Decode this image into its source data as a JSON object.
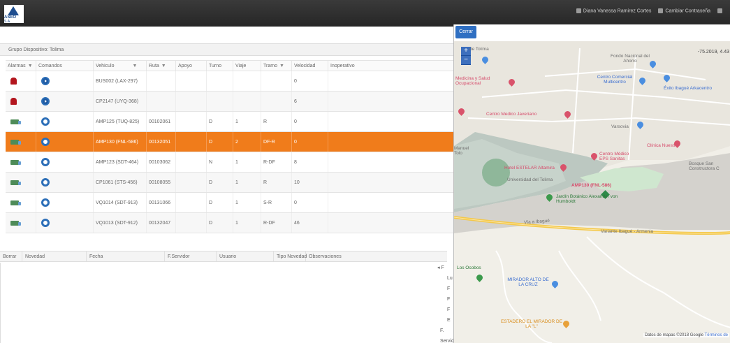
{
  "header": {
    "logo_text": "ASEO",
    "logo_sub": "S.A.",
    "user_name": "Diana Vanessa Ramirez Cortes",
    "change_password": "Cambiar Contraseña"
  },
  "group": {
    "label": "Grupo Dispositivo: Tolima"
  },
  "device_table": {
    "columns": [
      "Alarmas",
      "Comandos",
      "Vehiculo",
      "Ruta",
      "Apoyo",
      "Turno",
      "Viaje",
      "Tramo",
      "Velocidad",
      "Inoperativo"
    ],
    "rows": [
      {
        "vehicle": "BUS002 (LAX-297)",
        "route": "",
        "support": "",
        "shift": "",
        "trip": "",
        "segment": "",
        "speed": "0",
        "alarm": "alarm-bell",
        "command": "play"
      },
      {
        "vehicle": "CP2147 (UYQ-368)",
        "route": "",
        "support": "",
        "shift": "",
        "trip": "",
        "segment": "",
        "speed": "6",
        "alarm": "alarm-bell",
        "command": "play"
      },
      {
        "vehicle": "AMP125 (TUQ-825)",
        "route": "00102061",
        "support": "",
        "shift": "D",
        "trip": "1",
        "segment": "R",
        "speed": "0",
        "alarm": "truck",
        "command": "ring"
      },
      {
        "vehicle": "AMP130 (FNL-586)",
        "route": "00132051",
        "support": "",
        "shift": "D",
        "trip": "2",
        "segment": "DF-R",
        "speed": "0",
        "alarm": "truck",
        "command": "ring",
        "selected": true
      },
      {
        "vehicle": "AMP123 (SDT-464)",
        "route": "00103062",
        "support": "",
        "shift": "N",
        "trip": "1",
        "segment": "R-DF",
        "speed": "8",
        "alarm": "truck",
        "command": "ring"
      },
      {
        "vehicle": "CP1061 (STS-456)",
        "route": "00108055",
        "support": "",
        "shift": "D",
        "trip": "1",
        "segment": "R",
        "speed": "10",
        "alarm": "truck",
        "command": "ring"
      },
      {
        "vehicle": "VQ1014 (SDT-913)",
        "route": "00131066",
        "support": "",
        "shift": "D",
        "trip": "1",
        "segment": "S-R",
        "speed": "0",
        "alarm": "truck",
        "command": "ring"
      },
      {
        "vehicle": "VQ1013 (SDT-912)",
        "route": "00132047",
        "support": "",
        "shift": "D",
        "trip": "1",
        "segment": "R-DF",
        "speed": "46",
        "alarm": "truck",
        "command": "ring"
      }
    ]
  },
  "events_table": {
    "columns": [
      "Borrar",
      "Novedad",
      "Fecha",
      "F.Servidor",
      "Usuario",
      "Tipo Novedad",
      "Observaciones"
    ]
  },
  "side_strip": {
    "rows": [
      "F",
      "Lu",
      "F",
      "F",
      "F",
      "E",
      "F. Servidor"
    ],
    "arrow": "◂"
  },
  "map_modal": {
    "close_label": "Cerrar",
    "zoom_in": "+",
    "zoom_out": "−",
    "coordinates": "-75.2019, 4.43",
    "attribution": "Datos de mapas ©2018 Google",
    "attribution_link": "Términos de",
    "labels": {
      "tolima": "de Tolima",
      "fondo": "Fondo Nacional del Ahorro",
      "medicina": "Medicina y Salud Ocupacional",
      "centro_comercial": "Centro Comercial Multicentro",
      "exito": "Éxito Ibagué Arkacentro",
      "centro_medico_jav": "Centro Medico Javeriano",
      "varsovia": "Varsovia",
      "clinica": "Clínica Nuestra",
      "manuel": "Manuel Tolo",
      "centro_medico_eps": "Centro Médico EPS Sanitas",
      "bosque": "Bosque San Constructora C",
      "hotel": "Hotel ESTELAR Altamira",
      "universidad": "Universidad del Tolima",
      "vehicle_marker": "AMP130 (FNL-586)",
      "jardin": "Jardín Botánico Alexander von Humboldt",
      "via_ibague": "Vía a Ibagué",
      "variante": "Variante Ibagué - Armenia",
      "ocobos": "Los Ocobos",
      "mirador_alto": "MIRADOR ALTO DE LA CRUZ",
      "estadero": "ESTADERO EL MIRADOR DE LA \"L\""
    }
  }
}
